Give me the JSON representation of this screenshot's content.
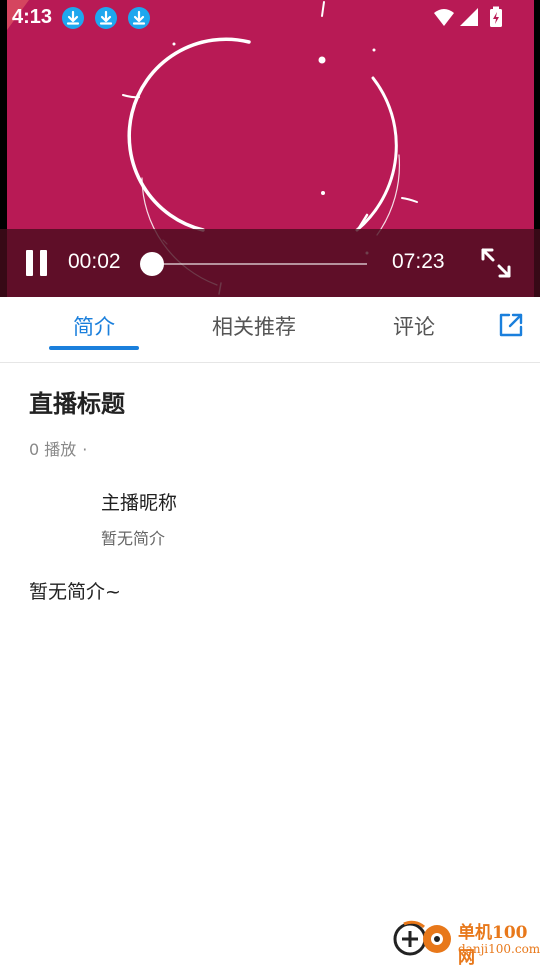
{
  "status_bar": {
    "time": "4:13"
  },
  "player": {
    "current_time": "00:02",
    "duration": "07:23",
    "progress_fraction": 0.005,
    "frame_color": "#b81a55"
  },
  "tabs": [
    {
      "label": "简介",
      "active": true
    },
    {
      "label": "相关推荐",
      "active": false
    },
    {
      "label": "评论",
      "active": false
    }
  ],
  "accent_color": "#1a7fdc",
  "content": {
    "title": "直播标题",
    "play_count": "0 播放",
    "meta_separator": "·",
    "anchor_name": "主播昵称",
    "anchor_desc": "暂无简介",
    "intro": "暂无简介~"
  },
  "watermark": {
    "line1": "单机100网",
    "line2": "danji100.com"
  },
  "icons": [
    "download-icon",
    "wifi-icon",
    "signal-icon",
    "battery-charging-icon",
    "pause-icon",
    "fullscreen-icon",
    "share-icon"
  ]
}
